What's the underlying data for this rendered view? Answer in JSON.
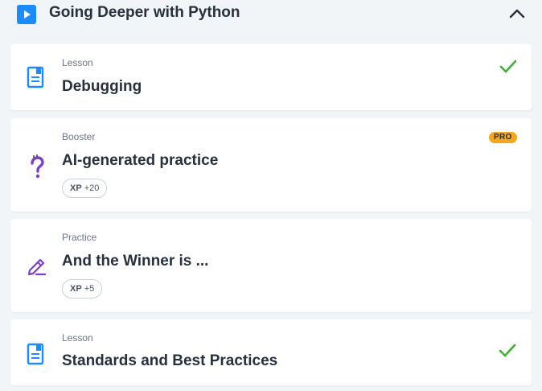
{
  "section": {
    "title": "Going Deeper with Python",
    "play_icon": "play-icon",
    "collapse_icon": "chevron-up-icon"
  },
  "items": [
    {
      "type": "Lesson",
      "title": "Debugging",
      "icon": "lesson-document-icon",
      "completed": true
    },
    {
      "type": "Booster",
      "title": "AI-generated practice",
      "icon": "question-mark-icon",
      "badge": "PRO",
      "xp_label": "XP",
      "xp_value": "+20",
      "completed": false
    },
    {
      "type": "Practice",
      "title": "And the Winner is ...",
      "icon": "pencil-edit-icon",
      "xp_label": "XP",
      "xp_value": "+5",
      "completed": false
    },
    {
      "type": "Lesson",
      "title": "Standards and Best Practices",
      "icon": "lesson-document-icon",
      "completed": true
    }
  ],
  "colors": {
    "background": "#f2f5f8",
    "accent_blue": "#1a8cff",
    "check_green": "#3cb22d",
    "booster_purple": "#7b3fd0",
    "pro_orange": "#f6a81d",
    "text_dark": "#27303c",
    "text_muted": "#6b7585"
  }
}
